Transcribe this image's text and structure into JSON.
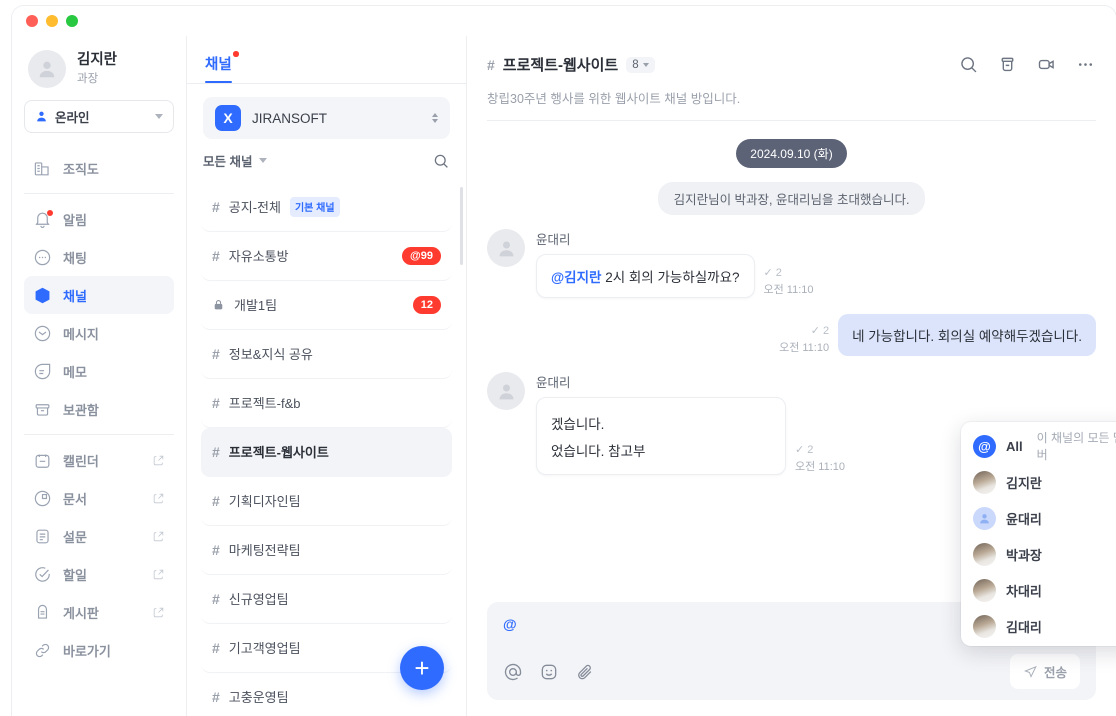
{
  "window": {
    "lights": [
      "close",
      "minimize",
      "zoom"
    ]
  },
  "rail": {
    "profile": {
      "name": "김지란",
      "role": "과장",
      "avatar_icon": "person-icon"
    },
    "status": {
      "label": "온라인",
      "icon": "person-filled-icon",
      "caret": "chevron-down-icon"
    },
    "section_top": [
      {
        "label": "조직도",
        "icon": "org-chart-icon",
        "active": false,
        "dot": false,
        "external": false
      }
    ],
    "section_main": [
      {
        "label": "알림",
        "icon": "bell-icon",
        "active": false,
        "dot": true,
        "external": false
      },
      {
        "label": "채팅",
        "icon": "chat-icon",
        "active": false,
        "dot": false,
        "external": false
      },
      {
        "label": "채널",
        "icon": "channel-cube-icon",
        "active": true,
        "dot": false,
        "external": false
      },
      {
        "label": "메시지",
        "icon": "envelope-icon",
        "active": false,
        "dot": false,
        "external": false
      },
      {
        "label": "메모",
        "icon": "memo-icon",
        "active": false,
        "dot": false,
        "external": false
      },
      {
        "label": "보관함",
        "icon": "archive-icon",
        "active": false,
        "dot": false,
        "external": false
      }
    ],
    "section_apps": [
      {
        "label": "캘린더",
        "icon": "calendar-icon",
        "active": false,
        "dot": false,
        "external": true
      },
      {
        "label": "문서",
        "icon": "document-icon",
        "active": false,
        "dot": false,
        "external": true
      },
      {
        "label": "설문",
        "icon": "survey-icon",
        "active": false,
        "dot": false,
        "external": true
      },
      {
        "label": "할일",
        "icon": "checkcircle-icon",
        "active": false,
        "dot": false,
        "external": true
      },
      {
        "label": "게시판",
        "icon": "board-icon",
        "active": false,
        "dot": false,
        "external": true
      },
      {
        "label": "바로가기",
        "icon": "link-icon",
        "active": false,
        "dot": false,
        "external": false
      }
    ]
  },
  "channels_panel": {
    "tab": {
      "label": "채널",
      "has_dot": true
    },
    "workspace": {
      "logo_letter": "X",
      "name": "JIRANSOFT"
    },
    "filter": {
      "label": "모든 채널",
      "search_icon": "search-icon"
    },
    "add_button_label": "+",
    "items": [
      {
        "name": "공지-전체",
        "prefix": "hash",
        "tag": "기본 채널",
        "badge": "",
        "selected": false
      },
      {
        "name": "자유소통방",
        "prefix": "hash",
        "tag": "",
        "badge": "@99",
        "selected": false
      },
      {
        "name": "개발1팀",
        "prefix": "lock",
        "tag": "",
        "badge": "12",
        "selected": false
      },
      {
        "name": "정보&지식 공유",
        "prefix": "hash",
        "tag": "",
        "badge": "",
        "selected": false
      },
      {
        "name": "프로젝트-f&b",
        "prefix": "hash",
        "tag": "",
        "badge": "",
        "selected": false
      },
      {
        "name": "프로젝트-웹사이트",
        "prefix": "hash",
        "tag": "",
        "badge": "",
        "selected": true
      },
      {
        "name": "기획디자인팀",
        "prefix": "hash",
        "tag": "",
        "badge": "",
        "selected": false
      },
      {
        "name": "마케팅전략팀",
        "prefix": "hash",
        "tag": "",
        "badge": "",
        "selected": false
      },
      {
        "name": "신규영업팀",
        "prefix": "hash",
        "tag": "",
        "badge": "",
        "selected": false
      },
      {
        "name": "기고객영업팀",
        "prefix": "hash",
        "tag": "",
        "badge": "",
        "selected": false
      },
      {
        "name": "고충운영팀",
        "prefix": "hash",
        "tag": "",
        "badge": "",
        "selected": false
      }
    ]
  },
  "chat": {
    "title": "프로젝트-웹사이트",
    "member_count": "8",
    "description": "창립30주년 행사를 위한 웹사이트 채널 방입니다.",
    "head_icons": [
      "search-icon",
      "archive-icon",
      "video-call-icon",
      "more-icon"
    ],
    "date_divider": "2024.09.10 (화)",
    "system_message": "김지란님이 박과장, 윤대리님을 초대했습니다.",
    "messages": [
      {
        "type": "incoming",
        "sender": "윤대리",
        "mention": "@김지란",
        "text": "2시 회의 가능하실까요?",
        "read_count": "2",
        "time": "오전 11:10"
      },
      {
        "type": "outgoing",
        "sender": "",
        "mention": "",
        "text": "네 가능합니다. 회의실 예약해두겠습니다.",
        "read_count": "2",
        "time": "오전 11:10"
      },
      {
        "type": "incoming",
        "sender": "윤대리",
        "mention": "",
        "text_line1": "겠습니다.",
        "text_line2": "었습니다. 참고부",
        "read_count": "2",
        "time": "오전 11:10"
      }
    ]
  },
  "mention_popup": {
    "rows": [
      {
        "name": "All",
        "sub": "이 채널의 모든 멤버",
        "avatar": "all-at-icon"
      },
      {
        "name": "김지란",
        "sub": "",
        "avatar": "photo"
      },
      {
        "name": "윤대리",
        "sub": "",
        "avatar": "placeholder"
      },
      {
        "name": "박과장",
        "sub": "",
        "avatar": "photo"
      },
      {
        "name": "차대리",
        "sub": "",
        "avatar": "photo"
      },
      {
        "name": "김대리",
        "sub": "",
        "avatar": "photo"
      }
    ]
  },
  "composer": {
    "value": "@",
    "icons": [
      "mention-icon",
      "emoji-icon",
      "attach-icon"
    ],
    "send_label": "전송",
    "send_icon": "send-icon"
  },
  "colors": {
    "accent": "#2f6bff",
    "badge_red": "#ff3b30",
    "bubble_out": "#dbe4fb",
    "date_pill": "#5d6377",
    "panel_bg": "#f3f4f7"
  }
}
